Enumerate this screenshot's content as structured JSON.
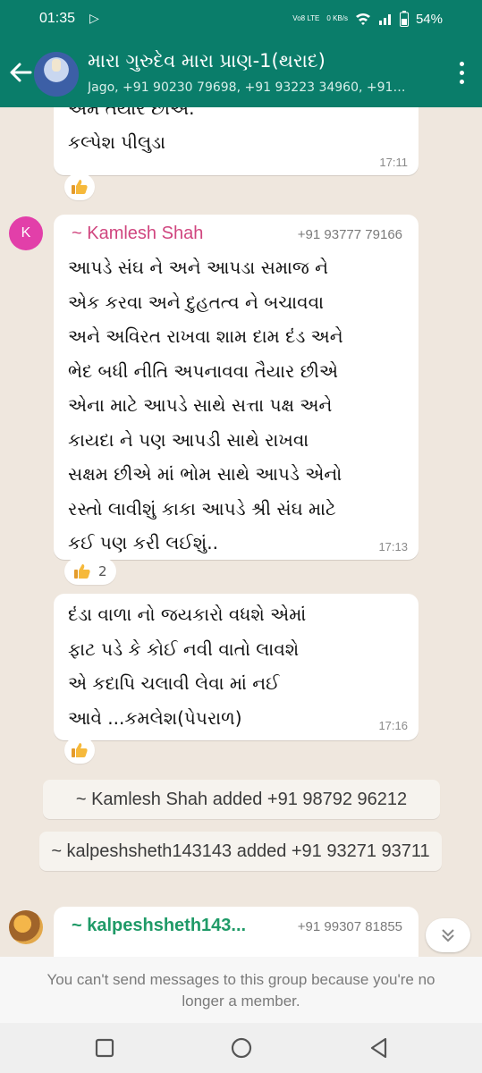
{
  "status": {
    "time": "01:35",
    "volte": "Vo8 LTE",
    "speed": "0 KB/s",
    "battery": "54%"
  },
  "header": {
    "title": "મારા ગુરુદેવ મારા પ્રાણ-1(થરાદ)",
    "subtitle": "Jago, +91 90230 79698, +91 93223 34960, +91…"
  },
  "messages": [
    {
      "text": "અમે તૈયાર છીએ.\nકલ્પેશ પીલુડા",
      "time": "17:11",
      "reaction": ""
    },
    {
      "avatar_letter": "K",
      "sender": "~ Kamlesh Shah",
      "phone": "+91 93777 79166",
      "text": "આપડે સંઘ ને અને આપડા સમાજ ને\nએક કરવા અને દુહતત્વ ને બચાવવા\nઅને અવિરત રાખવા શામ દામ દંડ અને\nભેદ બધી નીતિ અપનાવવા તૈયાર છીએ\nએના માટે  આપડે સાથે સત્તા પક્ષ અને\nકાયદા ને પણ આપડી સાથે રાખવા\nસક્ષમ છીએ માં ભોમ સાથે આપડે એનો\nરસ્તો લાવીશું કાકા આપડે શ્રી સંઘ માટે\nકઈ પણ કરી લઈશું..",
      "time": "17:13",
      "reaction": "2"
    },
    {
      "text": "દંડા વાળા નો જયકારો વધશે એમાં\nફાટ પડે કે કોઈ નવી વાતો લાવશે\nએ કદાપિ ચલાવી લેવા માં નઈ\nઆવે ...કમલેશ(પેપરાળ)",
      "time": "17:16",
      "reaction": ""
    },
    {
      "sender": "~ kalpeshsheth143...",
      "phone": "+91 99307 81855"
    }
  ],
  "system": [
    "~ Kamlesh Shah added +91 98792 96212",
    "~ kalpeshsheth143143 added +91 93271 93711"
  ],
  "footer": {
    "notice": "You can't send messages to this group because you're no longer a member."
  },
  "colors": {
    "brand": "#0a7d6a",
    "sender_pink": "#d0467f",
    "sender_green": "#1f9a67"
  }
}
